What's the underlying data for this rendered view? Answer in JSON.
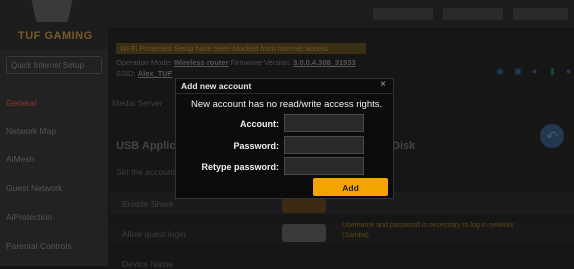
{
  "logo": {
    "text": "TUF GAMING"
  },
  "sidebar": {
    "quick_setup": "Quick Internet Setup",
    "items": [
      {
        "label": "General"
      },
      {
        "label": "Network Map"
      },
      {
        "label": "AiMesh"
      },
      {
        "label": "Guest Network"
      },
      {
        "label": "AiProtection"
      },
      {
        "label": "Parental Controls"
      }
    ]
  },
  "header": {
    "notice": "Wi-Fi Protected Setup have been blocked from Internet access",
    "operation_mode_label": "Operation Mode:",
    "operation_mode_value": "Wireless router",
    "firmware_label": "Firmware Version:",
    "firmware_value": "3.0.0.4.388_31933",
    "ssid_label": "SSID:",
    "ssid_value": "Alex_TUF",
    "media_server_label": "Media Server"
  },
  "main": {
    "section_title": "USB Application",
    "section_title_right": "Disk",
    "description": "Set the account",
    "rows": [
      {
        "label": "Enable Share"
      },
      {
        "label": "Allow guest login"
      },
      {
        "label": "Device Name"
      }
    ],
    "hint": "Username and password is necessary to log in network (Samba)"
  },
  "modal": {
    "title": "Add new account",
    "close": "×",
    "message": "New account has no read/write access rights.",
    "fields": [
      {
        "label": "Account:",
        "value": ""
      },
      {
        "label": "Password:",
        "value": ""
      },
      {
        "label": "Retype password:",
        "value": ""
      }
    ],
    "add_label": "Add"
  },
  "colors": {
    "accent": "#f5a300",
    "modal_bg": "#0c0c0c",
    "input_bg": "#2a2a2a"
  }
}
